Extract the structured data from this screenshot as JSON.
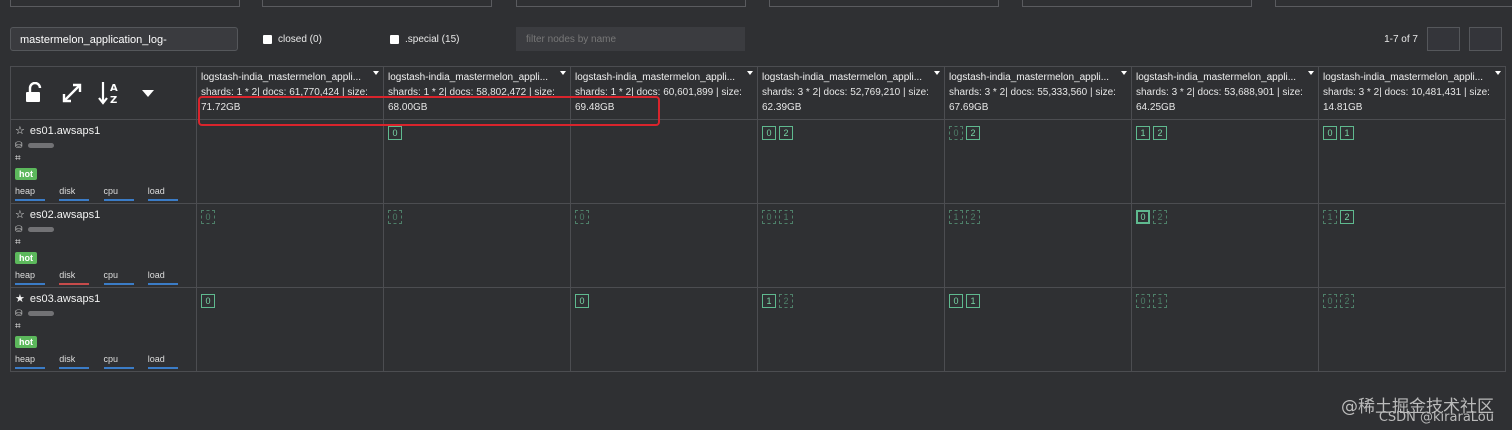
{
  "filter": {
    "index_value": "mastermelon_application_log-",
    "closed_label": "closed (0)",
    "special_label": ".special (15)",
    "node_filter_placeholder": "filter nodes by name",
    "page_count": "1-7 of 7"
  },
  "toolbar": {
    "lock_icon": "unlock-icon",
    "expand_icon": "expand-arrows-icon",
    "sort_icon": "sort-alpha-icon",
    "menu_icon": "caret-down-icon"
  },
  "indices": [
    {
      "name": "logstash-india_mastermelon_appli...",
      "stats_a": "shards: 1 * 2| docs: 61,770,424 | size:",
      "stats_b": "71.72GB"
    },
    {
      "name": "logstash-india_mastermelon_appli...",
      "stats_a": "shards: 1 * 2| docs: 58,802,472 | size:",
      "stats_b": "68.00GB"
    },
    {
      "name": "logstash-india_mastermelon_appli...",
      "stats_a": "shards: 1 * 2| docs: 60,601,899 | size:",
      "stats_b": "69.48GB"
    },
    {
      "name": "logstash-india_mastermelon_appli...",
      "stats_a": "shards: 3 * 2| docs: 52,769,210 | size:",
      "stats_b": "62.39GB"
    },
    {
      "name": "logstash-india_mastermelon_appli...",
      "stats_a": "shards: 3 * 2| docs: 55,333,560 | size:",
      "stats_b": "67.69GB"
    },
    {
      "name": "logstash-india_mastermelon_appli...",
      "stats_a": "shards: 3 * 2| docs: 53,688,901 | size:",
      "stats_b": "64.25GB"
    },
    {
      "name": "logstash-india_mastermelon_appli...",
      "stats_a": "shards: 3 * 2| docs: 10,481,431 | size:",
      "stats_b": "14.81GB"
    }
  ],
  "nodes": [
    {
      "name": "es01.awsaps1",
      "master": false,
      "tag": "hot",
      "metrics": [
        "heap",
        "disk",
        "cpu",
        "load"
      ]
    },
    {
      "name": "es02.awsaps1",
      "master": false,
      "tag": "hot",
      "metrics": [
        "heap",
        "disk",
        "cpu",
        "load"
      ]
    },
    {
      "name": "es03.awsaps1",
      "master": true,
      "tag": "hot",
      "metrics": [
        "heap",
        "disk",
        "cpu",
        "load"
      ]
    }
  ],
  "shards": [
    [
      [],
      [
        {
          "n": "0",
          "t": "replica"
        }
      ],
      [],
      [
        {
          "n": "0",
          "t": "replica"
        },
        {
          "n": "2",
          "t": "replica"
        }
      ],
      [
        {
          "n": "0",
          "t": "unassigned"
        },
        {
          "n": "2",
          "t": "replica"
        }
      ],
      [
        {
          "n": "1",
          "t": "replica"
        },
        {
          "n": "2",
          "t": "replica"
        }
      ],
      [
        {
          "n": "0",
          "t": "replica"
        },
        {
          "n": "1",
          "t": "replica"
        }
      ]
    ],
    [
      [
        {
          "n": "0",
          "t": "unassigned"
        }
      ],
      [
        {
          "n": "0",
          "t": "unassigned"
        }
      ],
      [
        {
          "n": "0",
          "t": "unassigned"
        }
      ],
      [
        {
          "n": "0",
          "t": "unassigned"
        },
        {
          "n": "1",
          "t": "unassigned"
        }
      ],
      [
        {
          "n": "1",
          "t": "unassigned"
        },
        {
          "n": "2",
          "t": "unassigned"
        }
      ],
      [
        {
          "n": "0",
          "t": "primary"
        },
        {
          "n": "2",
          "t": "unassigned"
        }
      ],
      [
        {
          "n": "1",
          "t": "unassigned"
        },
        {
          "n": "2",
          "t": "replica"
        }
      ]
    ],
    [
      [
        {
          "n": "0",
          "t": "replica"
        }
      ],
      [],
      [
        {
          "n": "0",
          "t": "replica"
        }
      ],
      [
        {
          "n": "1",
          "t": "replica"
        },
        {
          "n": "2",
          "t": "unassigned"
        }
      ],
      [
        {
          "n": "0",
          "t": "replica"
        },
        {
          "n": "1",
          "t": "replica"
        }
      ],
      [
        {
          "n": "0",
          "t": "unassigned"
        },
        {
          "n": "1",
          "t": "unassigned"
        }
      ],
      [
        {
          "n": "0",
          "t": "unassigned"
        },
        {
          "n": "2",
          "t": "unassigned"
        }
      ]
    ]
  ],
  "watermark": {
    "line1": "@稀土掘金技术社区",
    "line2": "CSDN @kiraraLou"
  }
}
